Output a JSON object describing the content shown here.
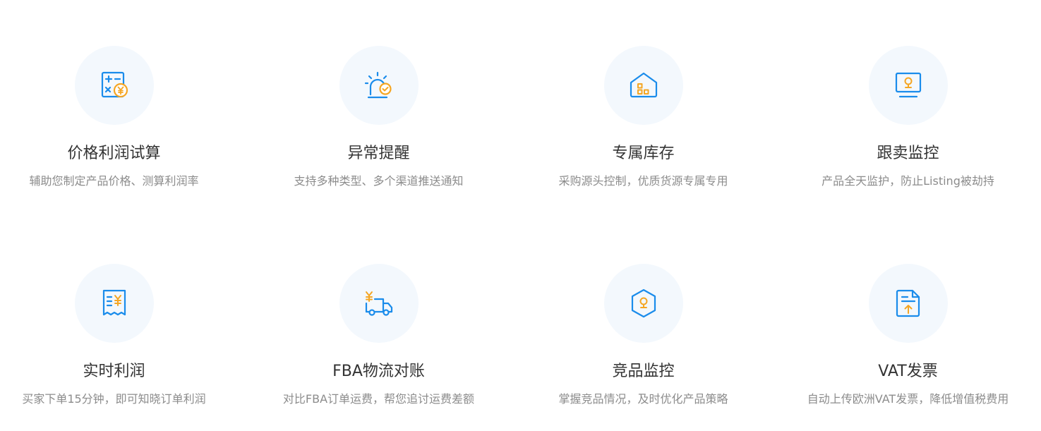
{
  "features": [
    {
      "title": "价格利润试算",
      "desc": "辅助您制定产品价格、测算利润率",
      "icon": "calculator-yuan-icon"
    },
    {
      "title": "异常提醒",
      "desc": "支持多种类型、多个渠道推送通知",
      "icon": "alarm-light-icon"
    },
    {
      "title": "专属库存",
      "desc": "采购源头控制，优质货源专属专用",
      "icon": "warehouse-icon"
    },
    {
      "title": "跟卖监控",
      "desc": "产品全天监护，防止Listing被劫持",
      "icon": "monitor-camera-icon"
    },
    {
      "title": "实时利润",
      "desc": "买家下单15分钟，即可知晓订单利润",
      "icon": "receipt-yuan-icon"
    },
    {
      "title": "FBA物流对账",
      "desc": "对比FBA订单运费，帮您追讨运费差额",
      "icon": "truck-yuan-icon"
    },
    {
      "title": "竞品监控",
      "desc": "掌握竞品情况，及时优化产品策略",
      "icon": "hexagon-camera-icon"
    },
    {
      "title": "VAT发票",
      "desc": "自动上传欧洲VAT发票，降低增值税费用",
      "icon": "document-upload-icon"
    }
  ],
  "colors": {
    "icon_blue": "#1a8ceb",
    "icon_orange": "#f5a623",
    "circle_bg": "#f3f8fd",
    "title": "#333333",
    "desc": "#8c8c8c"
  }
}
